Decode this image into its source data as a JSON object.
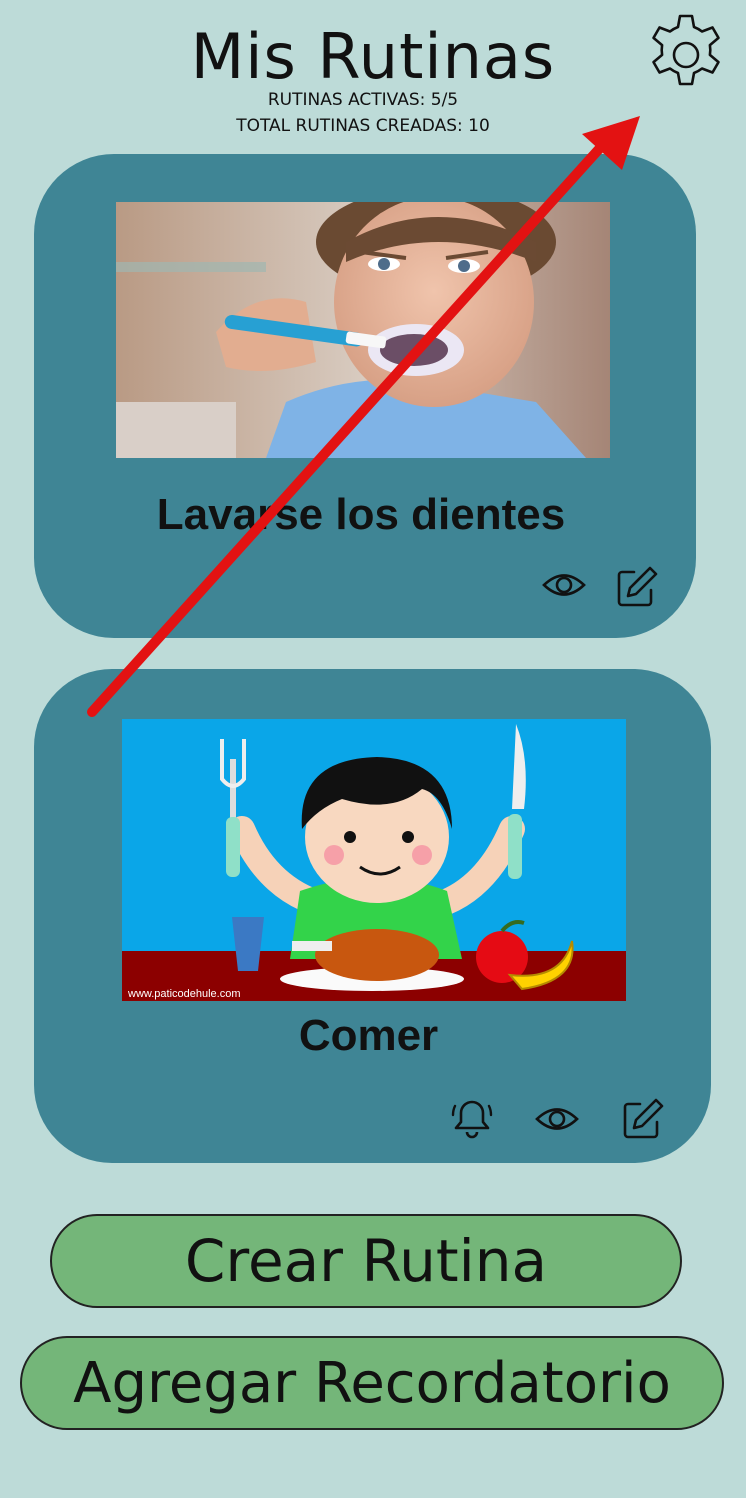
{
  "header": {
    "title": "Mis Rutinas",
    "active_routines": "RUTINAS ACTIVAS: 5/5",
    "total_routines": "TOTAL RUTINAS CREADAS: 10",
    "settings_icon": "gear-icon"
  },
  "routines": [
    {
      "title": "Lavarse los dientes",
      "image": "child-brushing-teeth-photo",
      "actions": [
        "eye-icon",
        "edit-icon"
      ]
    },
    {
      "title": "Comer",
      "image": "child-eating-illustration",
      "image_watermark": "www.paticodehule.com",
      "actions": [
        "bell-icon",
        "eye-icon",
        "edit-icon"
      ]
    }
  ],
  "buttons": {
    "create_routine": "Crear Rutina",
    "add_reminder": "Agregar Recordatorio"
  },
  "colors": {
    "background": "#bddbd8",
    "card": "#3f8595",
    "button": "#74b679",
    "annotation_arrow": "#e31212"
  }
}
